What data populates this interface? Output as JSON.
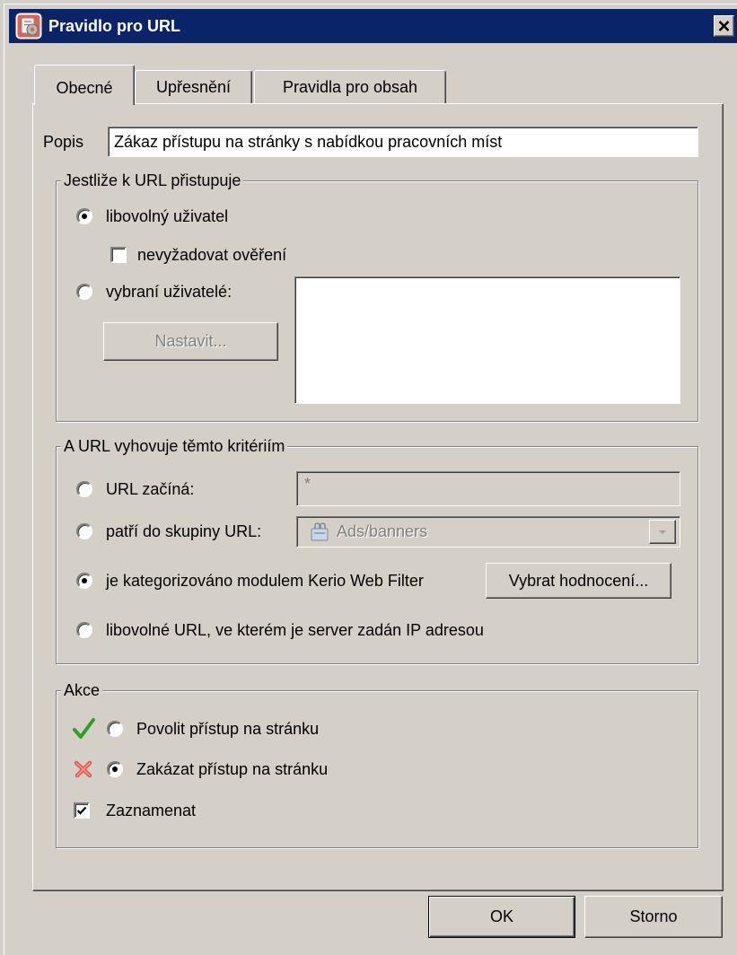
{
  "window": {
    "title": "Pravidlo pro URL",
    "title_icon": "url-rule-icon",
    "close_icon": "close-icon"
  },
  "tabs": [
    {
      "label": "Obecné",
      "selected": true
    },
    {
      "label": "Upřesnění",
      "selected": false
    },
    {
      "label": "Pravidla pro obsah",
      "selected": false
    }
  ],
  "description": {
    "label": "Popis",
    "value": "Zákaz přístupu na stránky s nabídkou pracovních míst"
  },
  "users_group": {
    "title": "Jestliže k URL přistupuje",
    "any_user": {
      "label": "libovolný uživatel",
      "checked": true
    },
    "no_auth": {
      "label": "nevyžadovat ověření",
      "checked": false
    },
    "selected_users": {
      "label": "vybraní uživatelé:",
      "checked": false
    },
    "set_button": {
      "label": "Nastavit...",
      "enabled": false
    },
    "users_list": []
  },
  "criteria_group": {
    "title": "A URL vyhovuje těmto kritériím",
    "url_starts": {
      "label": "URL začíná:",
      "checked": false,
      "value": "*"
    },
    "url_group": {
      "label": "patří do skupiny URL:",
      "checked": false,
      "selected": "Ads/banners",
      "item_icon": "url-group-icon"
    },
    "web_filter": {
      "label": "je kategorizováno modulem Kerio Web Filter",
      "checked": true,
      "button_label": "Vybrat hodnocení..."
    },
    "ip_address": {
      "label": "libovolné URL, ve kterém je server zadán IP adresou",
      "checked": false
    }
  },
  "action_group": {
    "title": "Akce",
    "allow": {
      "label": "Povolit přístup na stránku",
      "checked": false,
      "icon": "green-checkmark-icon",
      "icon_color": "#2ca02c"
    },
    "deny": {
      "label": "Zakázat přístup na stránku",
      "checked": true,
      "icon": "red-cross-icon",
      "icon_color": "#e2574c"
    },
    "log": {
      "label": "Zaznamenat",
      "checked": true
    }
  },
  "buttons": {
    "ok": "OK",
    "cancel": "Storno"
  },
  "colors": {
    "title_bar": "#0a246a",
    "face": "#d4d0c8",
    "disabled_text": "#808080",
    "title_text": "#ffffff"
  }
}
